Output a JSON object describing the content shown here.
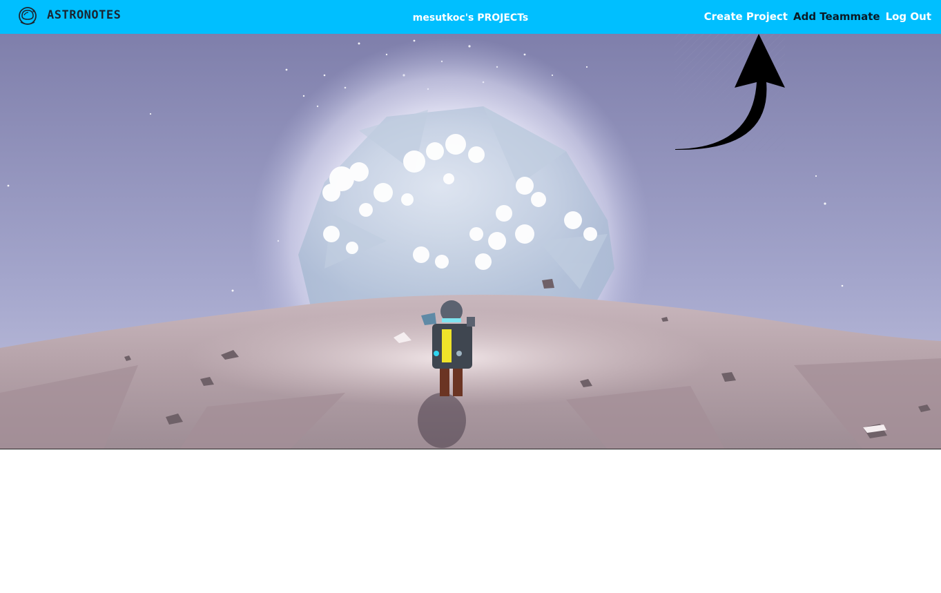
{
  "app": {
    "brand": "ASTRONOTES",
    "logo_icon": "astronaut-helmet-icon"
  },
  "header": {
    "title": "mesutkoc's PROJECTs",
    "background_color": "#00bfff"
  },
  "nav": {
    "create_project": "Create Project",
    "add_teammate": "Add Teammate",
    "log_out": "Log Out"
  },
  "hero": {
    "image": "astronaut-on-planet-illustration",
    "annotation_icon": "curved-arrow-up-icon"
  }
}
